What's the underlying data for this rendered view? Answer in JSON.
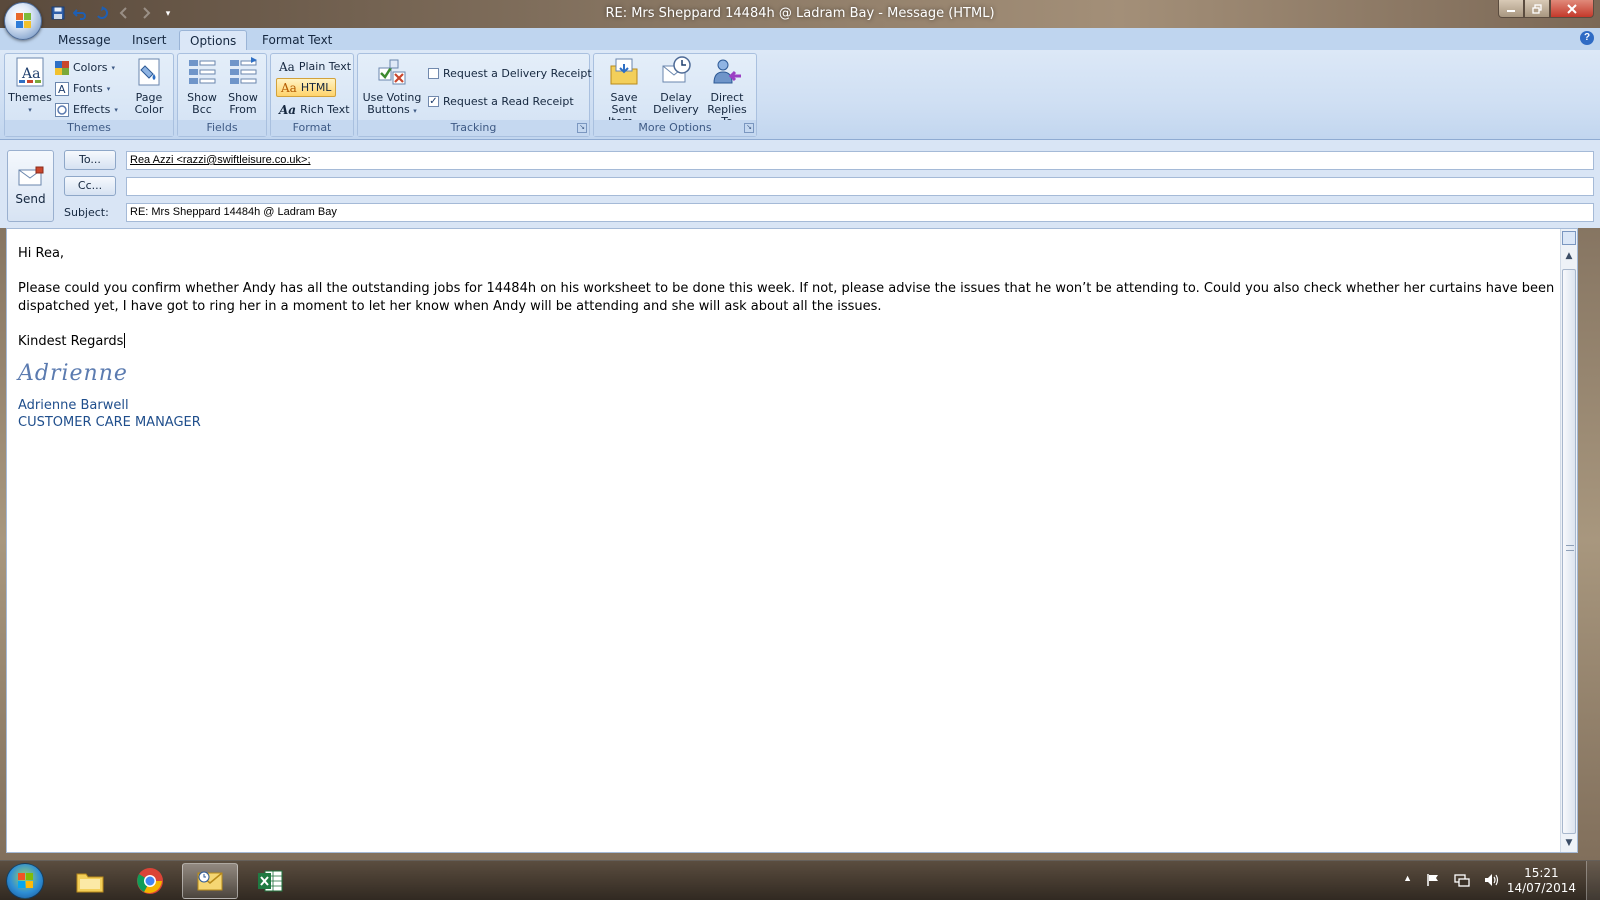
{
  "window": {
    "title": "RE: Mrs Sheppard 14484h @ Ladram Bay - Message (HTML)"
  },
  "ribbon": {
    "tabs": [
      "Message",
      "Insert",
      "Options",
      "Format Text"
    ],
    "active_tab": "Options",
    "themes": {
      "themes_label": "Themes",
      "colors_label": "Colors",
      "fonts_label": "Fonts",
      "effects_label": "Effects",
      "page_color_label_1": "Page",
      "page_color_label_2": "Color",
      "group_label": "Themes"
    },
    "fields": {
      "show_bcc_1": "Show",
      "show_bcc_2": "Bcc",
      "show_from_1": "Show",
      "show_from_2": "From",
      "group_label": "Fields"
    },
    "format": {
      "plain_text": "Plain Text",
      "html": "HTML",
      "rich_text": "Rich Text",
      "group_label": "Format"
    },
    "tracking": {
      "voting_1": "Use Voting",
      "voting_2": "Buttons",
      "delivery_receipt": "Request a Delivery Receipt",
      "delivery_receipt_checked": false,
      "read_receipt": "Request a Read Receipt",
      "read_receipt_checked": true,
      "group_label": "Tracking"
    },
    "more_options": {
      "save_sent_1": "Save Sent",
      "save_sent_2": "Item",
      "delay_1": "Delay",
      "delay_2": "Delivery",
      "direct_1": "Direct",
      "direct_2": "Replies To",
      "group_label": "More Options"
    }
  },
  "compose": {
    "send_label": "Send",
    "to_button": "To...",
    "cc_button": "Cc...",
    "to_value": "Rea Azzi <razzi@swiftleisure.co.uk>;",
    "cc_value": "",
    "subject_label": "Subject:",
    "subject_value": "RE: Mrs Sheppard 14484h @ Ladram Bay"
  },
  "body": {
    "greeting": "Hi Rea,",
    "paragraph": "Please could you confirm whether Andy has all the outstanding jobs for 14484h  on his worksheet to be done this week.  If not, please advise the issues that he won’t be attending to.  Could you also check whether her curtains have been dispatched yet, I have got to ring her in a moment to let her know when Andy will be attending and she will ask about all the issues.",
    "closing": "Kindest Regards",
    "signature_script": "Adrienne",
    "signature_name": "Adrienne Barwell",
    "signature_title": "CUSTOMER CARE MANAGER"
  },
  "taskbar": {
    "apps": [
      "file-explorer",
      "chrome",
      "outlook",
      "excel"
    ],
    "active_app": "outlook",
    "time": "15:21",
    "date": "14/07/2014"
  },
  "colors": {
    "ribbon_bg": "#dce8f7",
    "tab_bar_bg": "#bfd5ef",
    "signature_blue": "#1f4e8c",
    "html_highlight": "#ffd36b"
  }
}
